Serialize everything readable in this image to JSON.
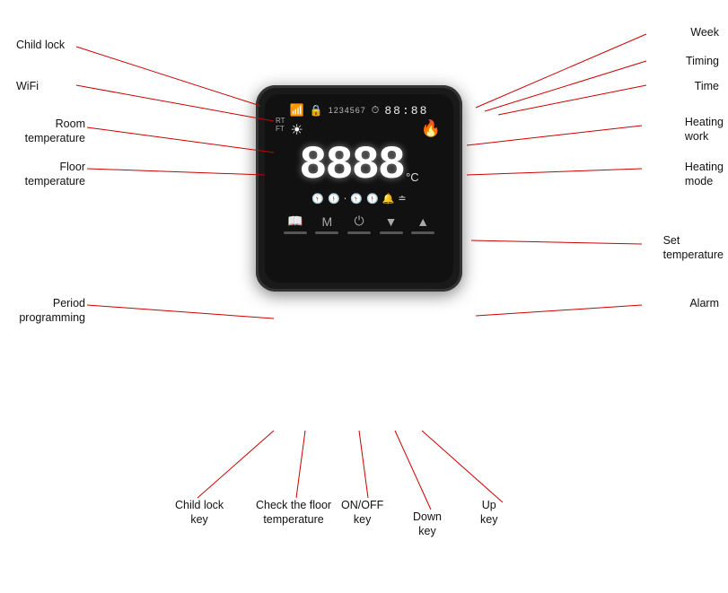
{
  "labels": {
    "child_lock": "Child lock",
    "wifi": "WiFi",
    "room_temperature": "Room\ntemperature",
    "floor_temperature": "Floor\ntemperature",
    "period_programming": "Period\nprogramming",
    "week": "Week",
    "timing": "Timing",
    "time": "Time",
    "heating_work": "Heating\nwork",
    "heating_mode": "Heating\nmode",
    "set_temperature": "Set\ntemperature",
    "alarm": "Alarm",
    "child_lock_key": "Child lock\nkey",
    "check_floor_temp": "Check the floor\ntemperature",
    "on_off_key": "ON/OFF\nkey",
    "down_key": "Down\nkey",
    "up_key": "Up\nkey"
  },
  "display": {
    "week_nums": "1234567",
    "time": "88:88",
    "big_digits": "8888",
    "celsius": "°C"
  },
  "buttons": [
    {
      "icon": "📖",
      "unicode": "📖"
    },
    {
      "icon": "M",
      "unicode": "M"
    },
    {
      "icon": "⏻",
      "unicode": "⏻"
    },
    {
      "icon": "▼",
      "unicode": "▼"
    },
    {
      "icon": "▲",
      "unicode": "▲"
    }
  ],
  "colors": {
    "line_color": "#cc0000",
    "device_bg": "#111111",
    "text_color": "#222222"
  }
}
